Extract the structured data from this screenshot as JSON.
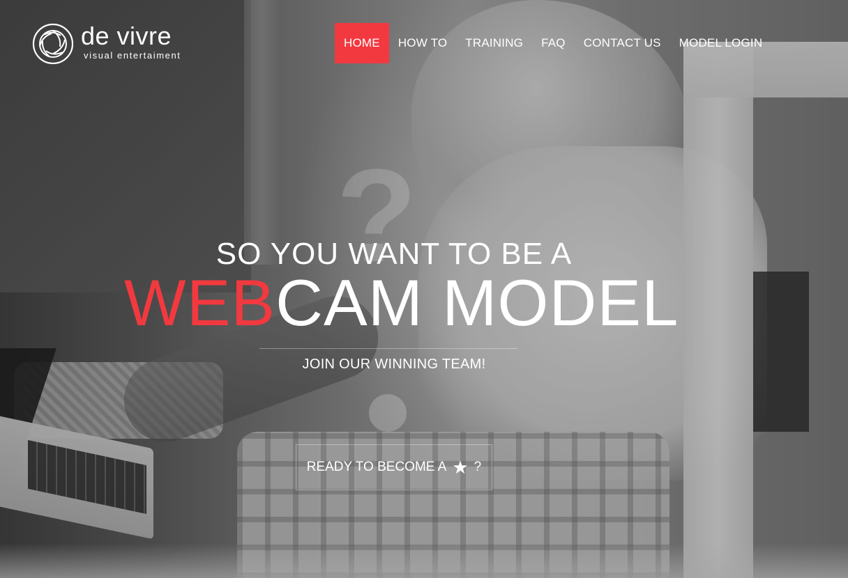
{
  "brand": {
    "name": "de vivre",
    "tagline": "visual entertaiment"
  },
  "nav": {
    "items": [
      {
        "label": "HOME",
        "active": true
      },
      {
        "label": "HOW TO",
        "active": false
      },
      {
        "label": "TRAINING",
        "active": false
      },
      {
        "label": "FAQ",
        "active": false
      },
      {
        "label": "CONTACT US",
        "active": false
      },
      {
        "label": "MODEL LOGIN",
        "active": false
      }
    ]
  },
  "hero": {
    "line1": "SO YOU WANT TO BE A",
    "accent": "WEB",
    "rest": "CAM MODEL",
    "subtitle": "JOIN OUR WINNING TEAM!",
    "ghost_mark": "?"
  },
  "cta": {
    "prefix": "READY TO BECOME A",
    "icon": "star-icon",
    "suffix": "?"
  },
  "colors": {
    "accent": "#f2393f",
    "text": "#ffffff"
  }
}
